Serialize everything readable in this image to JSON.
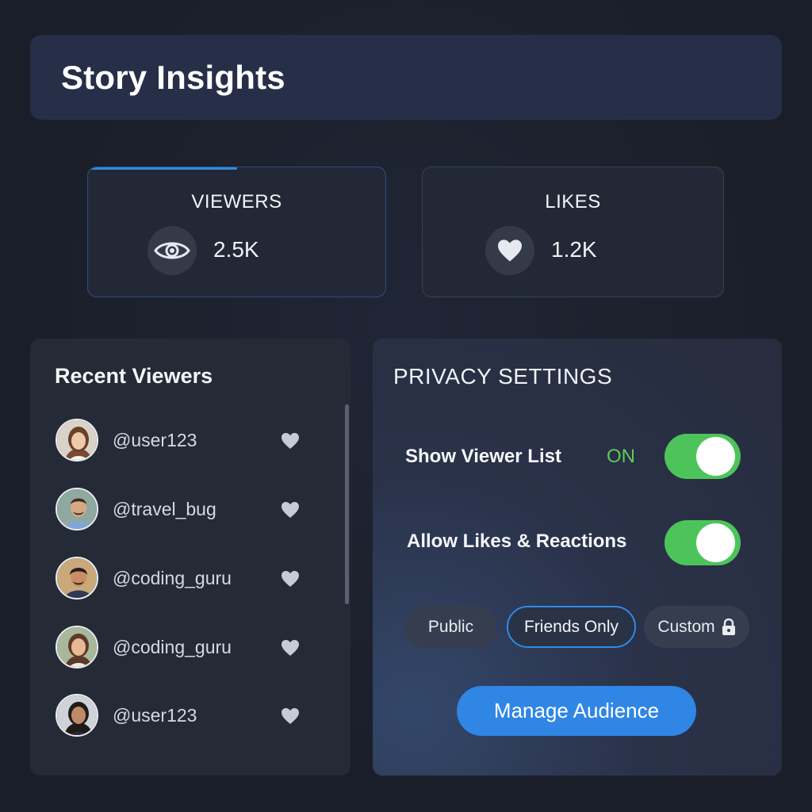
{
  "header": {
    "title": "Story Insights"
  },
  "stats": {
    "viewers": {
      "label": "VIEWERS",
      "value": "2.5K",
      "icon": "eye-icon"
    },
    "likes": {
      "label": "LIKES",
      "value": "1.2K",
      "icon": "heart-icon"
    }
  },
  "recent_viewers": {
    "title": "Recent Viewers",
    "items": [
      {
        "handle": "@user123",
        "icon": "heart-icon"
      },
      {
        "handle": "@travel_bug",
        "icon": "heart-icon"
      },
      {
        "handle": "@coding_guru",
        "icon": "heart-icon"
      },
      {
        "handle": "@coding_guru",
        "icon": "heart-icon"
      },
      {
        "handle": "@user123",
        "icon": "heart-icon"
      }
    ]
  },
  "privacy": {
    "title": "PRIVACY SETTINGS",
    "show_viewer_list": {
      "label": "Show Viewer List",
      "state_text": "ON",
      "enabled": true
    },
    "allow_likes": {
      "label": "Allow Likes & Reactions",
      "enabled": true
    },
    "audience_options": [
      "Public",
      "Friends Only",
      "Custom"
    ],
    "selected_audience": "Friends Only",
    "manage_button": "Manage Audience"
  },
  "colors": {
    "accent": "#2f8ae6",
    "toggle_on": "#4cc45a",
    "on_text": "#5fc95a",
    "header_bg": "#262f47"
  }
}
